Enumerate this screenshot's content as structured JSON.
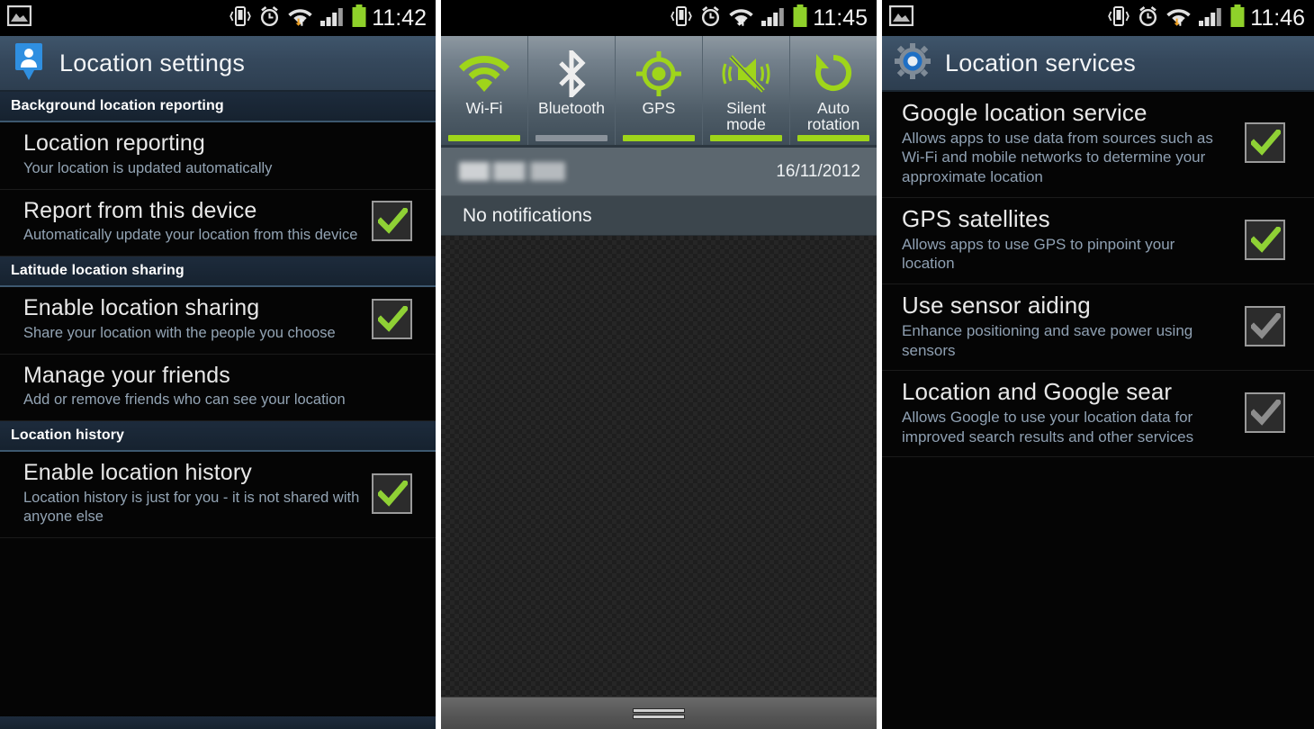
{
  "panel1": {
    "status_bar": {
      "time": "11:42",
      "left_icons": [
        "image-icon"
      ],
      "right_icons": [
        "vibrate-icon",
        "alarm-icon",
        "wifi-data-icon",
        "signal-bars-icon",
        "battery-icon"
      ]
    },
    "action_bar": {
      "title": "Location settings",
      "icon": "latitude-person-pin-icon"
    },
    "sections": [
      {
        "header": "Background location reporting",
        "rows": [
          {
            "title": "Location reporting",
            "subtitle": "Your location is updated automatically",
            "has_checkbox": false,
            "checked": false
          },
          {
            "title": "Report from this device",
            "subtitle": "Automatically update your location from this device",
            "has_checkbox": true,
            "checked": true
          }
        ]
      },
      {
        "header": "Latitude location sharing",
        "rows": [
          {
            "title": "Enable location sharing",
            "subtitle": "Share your location with the people you choose",
            "has_checkbox": true,
            "checked": true
          },
          {
            "title": "Manage your friends",
            "subtitle": "Add or remove friends who can see your location",
            "has_checkbox": false,
            "checked": false
          }
        ]
      },
      {
        "header": "Location history",
        "rows": [
          {
            "title": "Enable location history",
            "subtitle": "Location history is just for you - it is not shared with anyone else",
            "has_checkbox": true,
            "checked": true
          }
        ]
      }
    ],
    "clipped_section_header": ""
  },
  "panel2": {
    "status_bar": {
      "time": "11:45"
    },
    "quick_toggles": [
      {
        "label": "Wi-Fi",
        "icon": "wifi-icon",
        "state": "on"
      },
      {
        "label": "Bluetooth",
        "icon": "bluetooth-icon",
        "state": "off"
      },
      {
        "label": "GPS",
        "icon": "gps-crosshair-icon",
        "state": "on"
      },
      {
        "label": "Silent\nmode",
        "icon": "mute-vibrate-icon",
        "state": "on"
      },
      {
        "label": "Auto\nrotation",
        "icon": "rotate-icon",
        "state": "on"
      }
    ],
    "quick_toggle_labels_line1": [
      "Wi-Fi",
      "Bluetooth",
      "GPS",
      "Silent",
      "Auto"
    ],
    "quick_toggle_labels_line2": [
      "",
      "",
      "",
      "mode",
      "rotation"
    ],
    "notification_header": {
      "carrier": "",
      "date": "16/11/2012"
    },
    "no_notifications_label": "No notifications"
  },
  "panel3": {
    "status_bar": {
      "time": "11:46"
    },
    "action_bar": {
      "title": "Location services",
      "icon": "gear-icon"
    },
    "rows": [
      {
        "title": "Google location service",
        "subtitle": "Allows apps to use data from sources such as Wi-Fi and mobile networks to determine your approximate location",
        "checked": true,
        "check_color": "#8fd135"
      },
      {
        "title": "GPS satellites",
        "subtitle": "Allows apps to use GPS to pinpoint your location",
        "checked": true,
        "check_color": "#8fd135"
      },
      {
        "title": "Use sensor aiding",
        "subtitle": "Enhance positioning and save power using sensors",
        "checked": true,
        "check_color": "#8d8d8d"
      },
      {
        "title": "Location and Google sear",
        "subtitle": "Allows Google to use your location data for improved search results and other services",
        "checked": true,
        "check_color": "#8d8d8d"
      }
    ]
  },
  "colors": {
    "accent_green": "#9fd51a",
    "check_green": "#8fd135",
    "check_gray": "#8d8d8d",
    "action_bar": "#35485c",
    "section_header": "#1d2b3c",
    "battery_green": "#8fd12a"
  }
}
